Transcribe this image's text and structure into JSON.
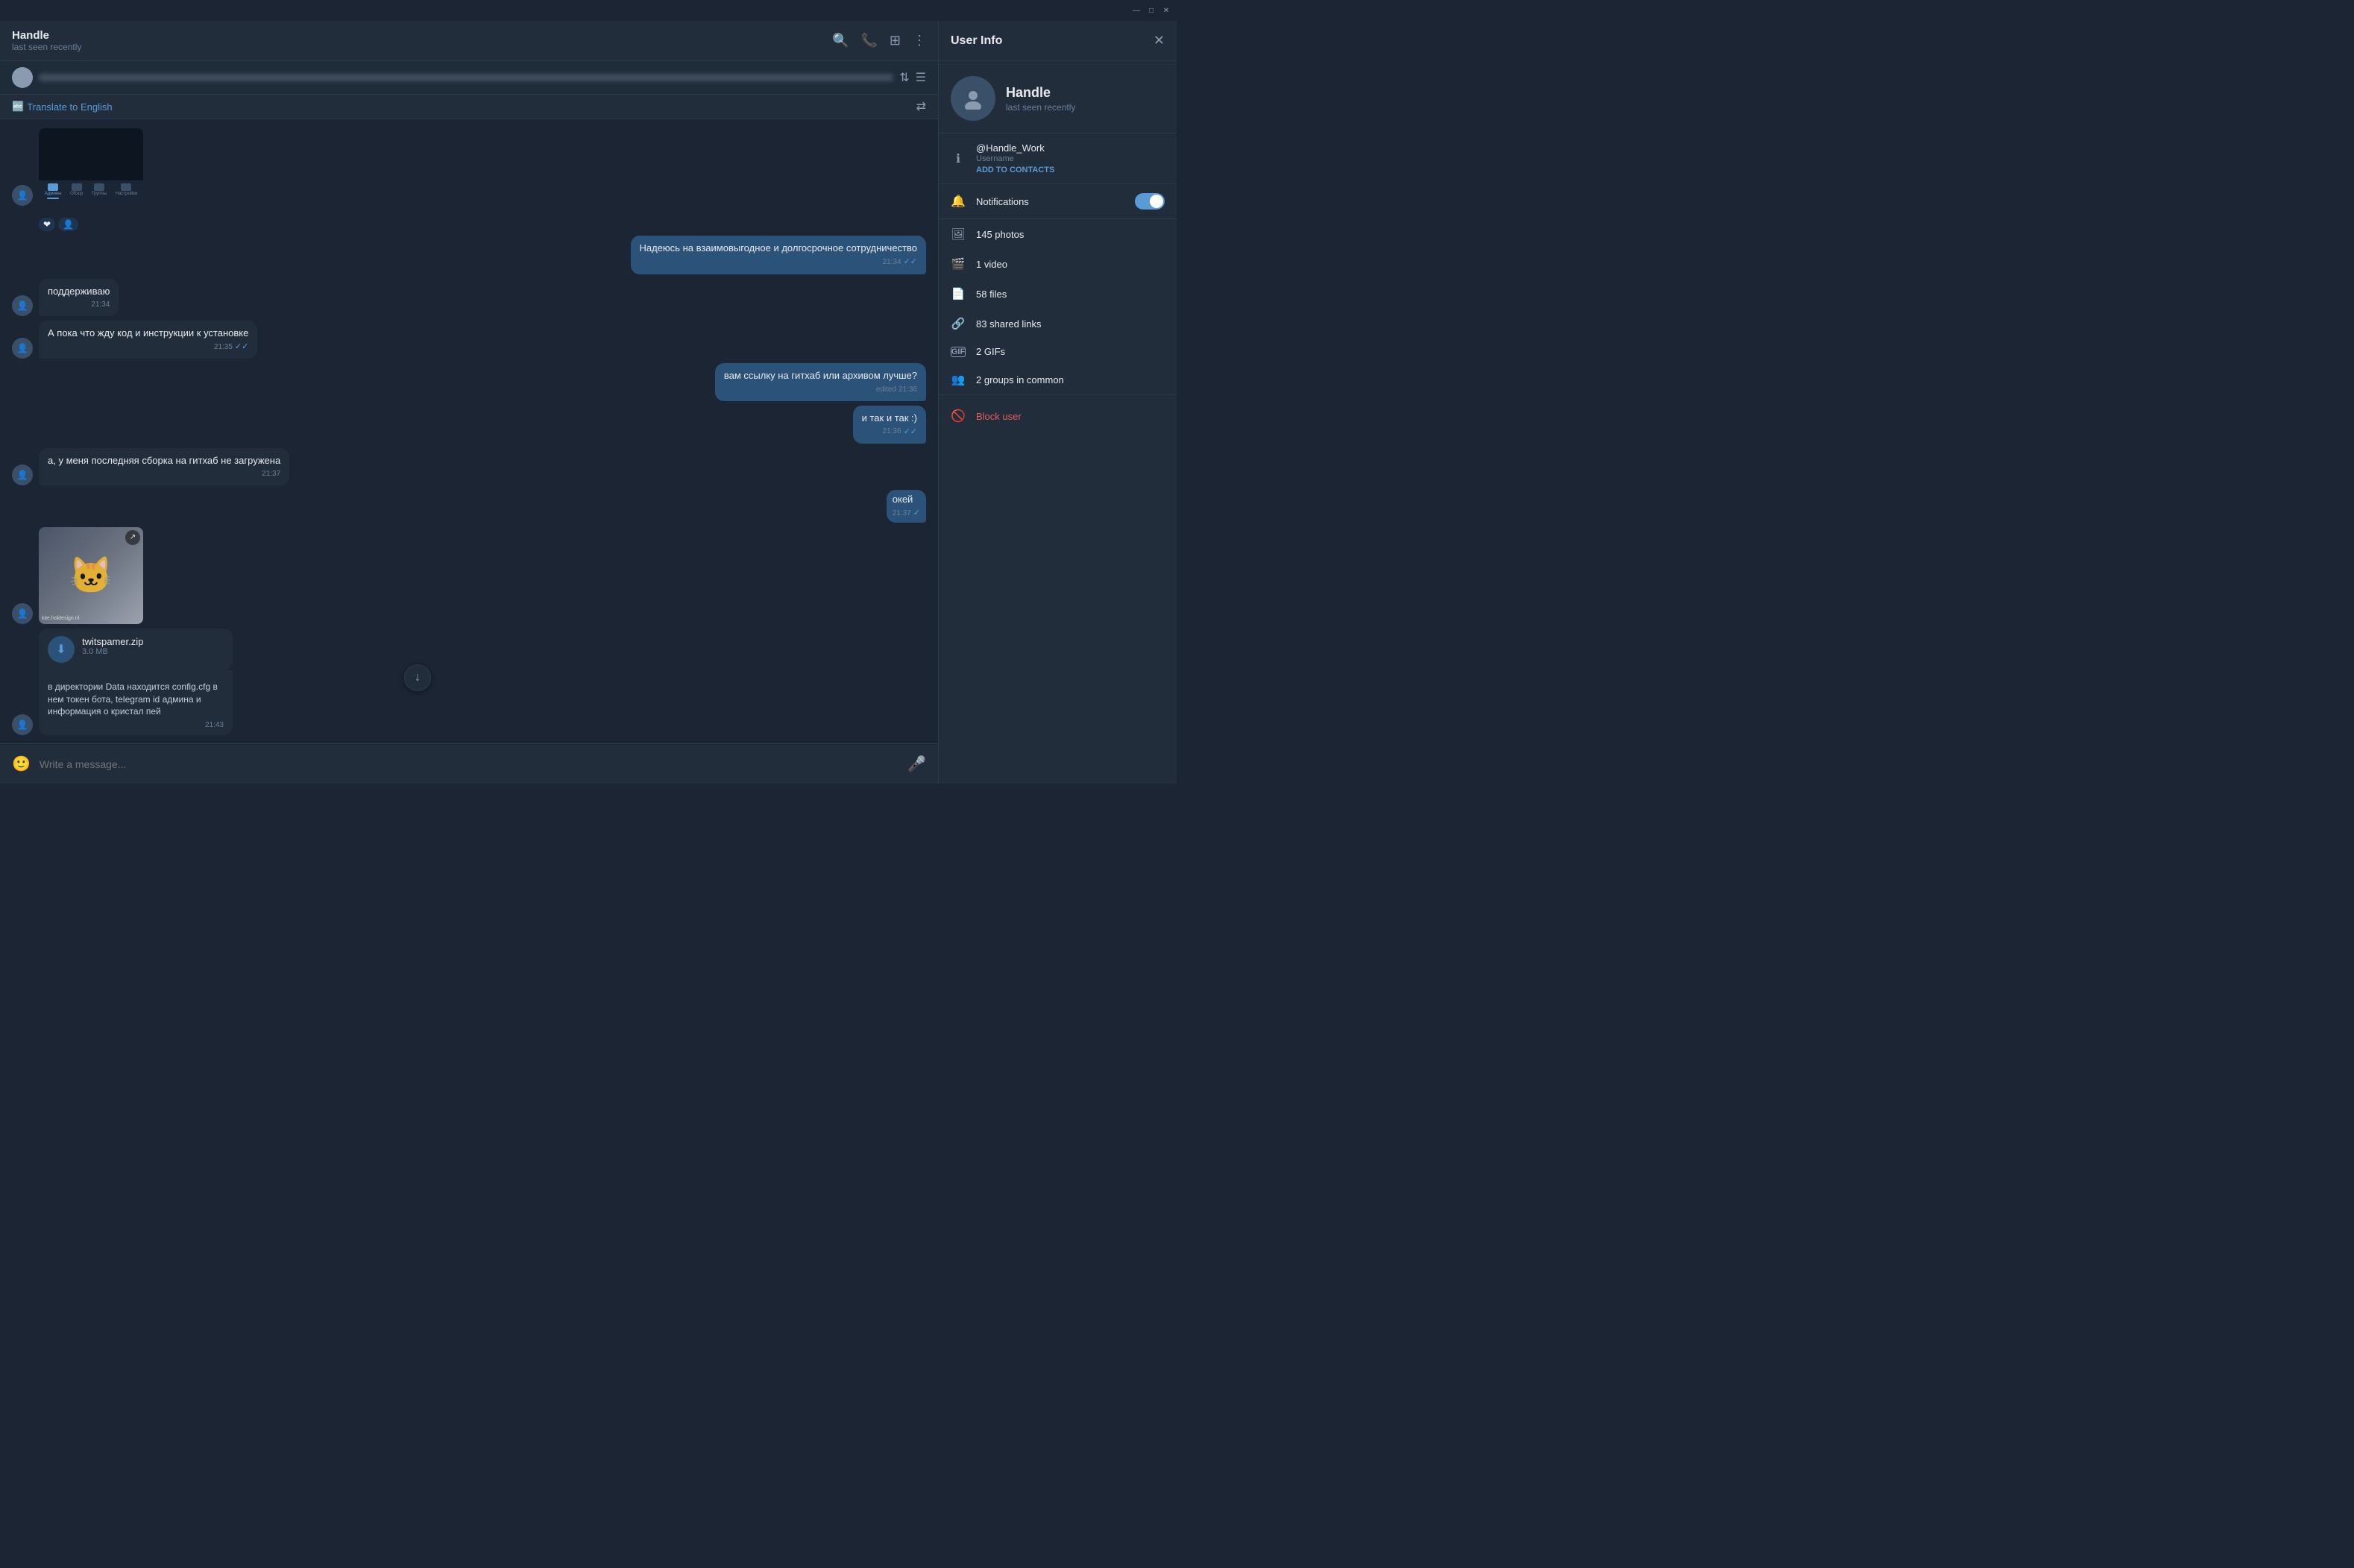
{
  "titlebar": {
    "minimize": "—",
    "maximize": "□",
    "close": "✕"
  },
  "chat": {
    "name": "Handle",
    "status": "last seen recently",
    "translate_btn": "Translate to English",
    "input_placeholder": "Write a message...",
    "scroll_to_bottom": "↓"
  },
  "messages": [
    {
      "id": 1,
      "type": "outgoing",
      "has_avatar": false,
      "text": "Надеюсь на взаимовыгодное и долгосрочное сотрудничество",
      "time": "21:34",
      "read": true,
      "reactions": [
        "❤",
        "👤"
      ]
    },
    {
      "id": 2,
      "type": "incoming",
      "has_avatar": true,
      "text": "поддерживаю",
      "time": "21:34",
      "read": false
    },
    {
      "id": 3,
      "type": "incoming",
      "has_avatar": true,
      "text": "А пока что жду код и инструкции к установке",
      "time": "21:35",
      "read": true
    },
    {
      "id": 4,
      "type": "outgoing",
      "has_avatar": false,
      "text": "вам ссылку на гитхаб или архивом лучше?",
      "time": "21:36",
      "edited": true,
      "read": false
    },
    {
      "id": 5,
      "type": "outgoing",
      "has_avatar": false,
      "text": "и так и так :)",
      "time": "21:36",
      "read": true
    },
    {
      "id": 6,
      "type": "incoming",
      "has_avatar": true,
      "text": "а, у меня последняя сборка на гитхаб не загружена",
      "time": "21:37",
      "read": false
    },
    {
      "id": 7,
      "type": "outgoing",
      "has_avatar": false,
      "text": "окей",
      "time": "21:37",
      "read": true,
      "has_image": true
    }
  ],
  "file_msg": {
    "name": "twitspamer.zip",
    "size": "3.0 MB",
    "text": "в директории Data находится config.cfg в нем токен бота, telegram id админа и информация о кристал пей",
    "time": "21:43"
  },
  "user_info": {
    "title": "User Info",
    "name": "Handle",
    "status": "last seen recently",
    "username": "@Handle_Work",
    "username_label": "Username",
    "add_to_contacts": "ADD TO CONTACTS",
    "notifications_label": "Notifications",
    "notifications_on": true,
    "photos": "145 photos",
    "video": "1 video",
    "files": "58 files",
    "shared_links": "83 shared links",
    "gifs": "2 GIFs",
    "groups": "2 groups in common",
    "block_user": "Block user"
  }
}
